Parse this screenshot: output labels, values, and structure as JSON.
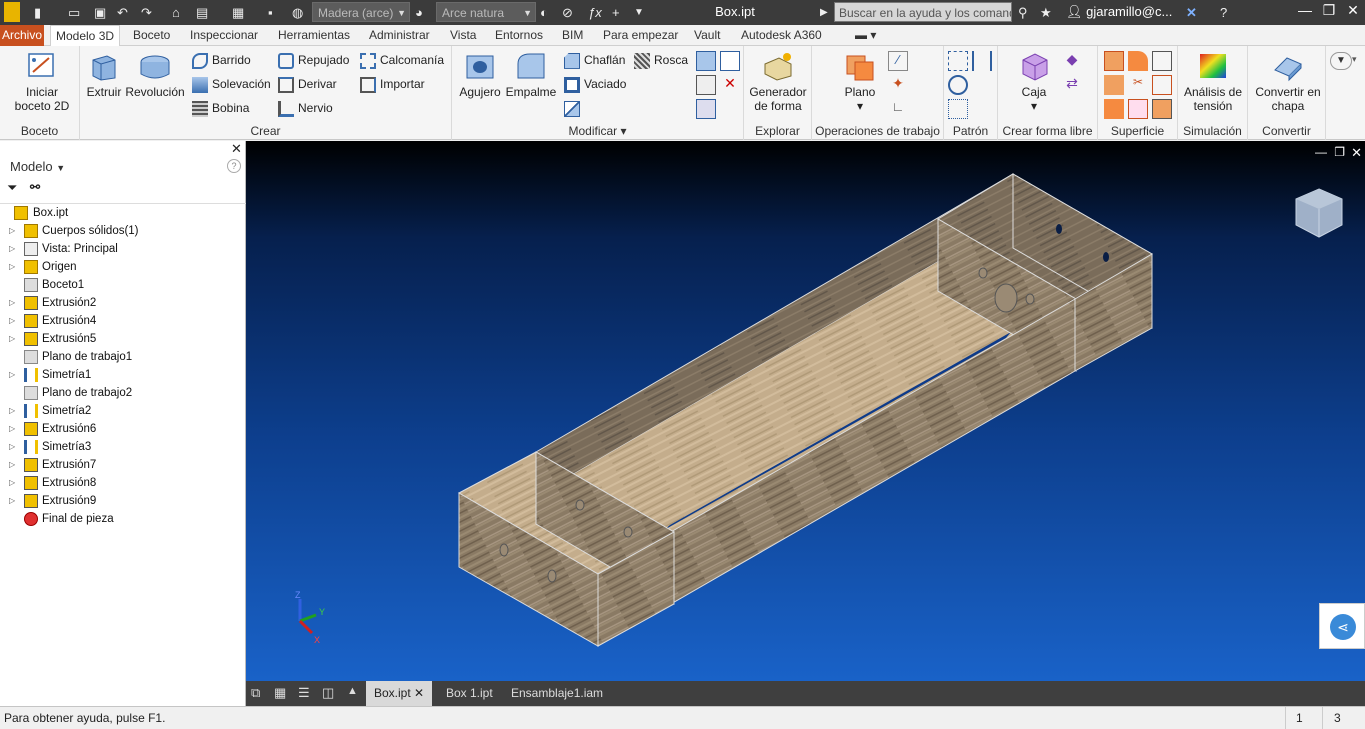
{
  "titlebar": {
    "material": "Madera (arce)",
    "appearance": "Arce natura",
    "doc_title": "Box.ipt",
    "search_placeholder": "Buscar en la ayuda y los comandos",
    "user": "gjaramillo@c..."
  },
  "menu_tabs": [
    "Archivo",
    "Modelo 3D",
    "Boceto",
    "Inspeccionar",
    "Herramientas",
    "Administrar",
    "Vista",
    "Entornos",
    "BIM",
    "Para empezar",
    "Vault",
    "Autodesk A360"
  ],
  "ribbon": {
    "boceto": {
      "label": "Boceto",
      "start_sketch": "Iniciar boceto 2D"
    },
    "crear": {
      "label": "Crear",
      "extruir": "Extruir",
      "revolucion": "Revolución",
      "barrido": "Barrido",
      "solevacion": "Solevación",
      "bobina": "Bobina",
      "repujado": "Repujado",
      "derivar": "Derivar",
      "nervio": "Nervio",
      "calcomania": "Calcomanía",
      "importar": "Importar"
    },
    "modificar": {
      "label": "Modificar",
      "agujero": "Agujero",
      "empalme": "Empalme",
      "chaflan": "Chaflán",
      "rosca": "Rosca",
      "vaciado": "Vaciado"
    },
    "explorar": {
      "label": "Explorar",
      "generador": "Generador de forma"
    },
    "operaciones": {
      "label": "Operaciones de trabajo",
      "plano": "Plano"
    },
    "patron": {
      "label": "Patrón"
    },
    "forma_libre": {
      "label": "Crear forma libre",
      "caja": "Caja"
    },
    "superficie": {
      "label": "Superficie"
    },
    "simulacion": {
      "label": "Simulación",
      "analisis": "Análisis de tensión"
    },
    "convertir": {
      "label": "Convertir",
      "chapa": "Convertir en chapa"
    }
  },
  "browser": {
    "title": "Modelo",
    "items": [
      {
        "label": "Box.ipt",
        "icon": "part-icon"
      },
      {
        "label": "Cuerpos sólidos(1)",
        "icon": "solid-bodies-icon"
      },
      {
        "label": "Vista: Principal",
        "icon": "view-icon"
      },
      {
        "label": "Origen",
        "icon": "folder-icon"
      },
      {
        "label": "Boceto1",
        "icon": "sketch-icon"
      },
      {
        "label": "Extrusión2",
        "icon": "extrude-icon"
      },
      {
        "label": "Extrusión4",
        "icon": "extrude-icon"
      },
      {
        "label": "Extrusión5",
        "icon": "extrude-icon"
      },
      {
        "label": "Plano de trabajo1",
        "icon": "workplane-icon"
      },
      {
        "label": "Simetría1",
        "icon": "mirror-icon"
      },
      {
        "label": "Plano de trabajo2",
        "icon": "workplane-icon"
      },
      {
        "label": "Simetría2",
        "icon": "mirror-icon"
      },
      {
        "label": "Extrusión6",
        "icon": "extrude-icon"
      },
      {
        "label": "Simetría3",
        "icon": "mirror-icon"
      },
      {
        "label": "Extrusión7",
        "icon": "extrude-icon"
      },
      {
        "label": "Extrusión8",
        "icon": "extrude-icon"
      },
      {
        "label": "Extrusión9",
        "icon": "extrude-icon"
      },
      {
        "label": "Final de pieza",
        "icon": "end-of-part-icon"
      }
    ]
  },
  "doc_tabs": [
    "Box.ipt",
    "Box 1.ipt",
    "Ensamblaje1.iam"
  ],
  "status": {
    "help": "Para obtener ayuda, pulse F1.",
    "count1": "1",
    "count2": "3"
  },
  "axes": {
    "x": "X",
    "y": "Y",
    "z": "Z"
  }
}
